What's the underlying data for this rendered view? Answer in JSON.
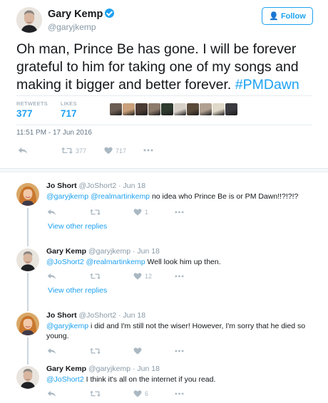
{
  "main_tweet": {
    "display_name": "Gary Kemp",
    "handle": "@garyjkemp",
    "follow_label": "Follow",
    "text": "Oh man, Prince Be has gone. I will be forever grateful to him for taking one of my songs and making it bigger and better forever. ",
    "hashtag": "#PMDawn",
    "retweets_label": "RETWEETS",
    "retweets_count": "377",
    "likes_label": "LIKES",
    "likes_count": "717",
    "timestamp": "11:51 PM - 17 Jun 2016",
    "action_retweets": "377",
    "action_likes": "717",
    "liker_avatar_colors": [
      "#6b5d52",
      "#c9a07a",
      "#4a3b35",
      "#8c7a6b",
      "#2f3a2f",
      "#d8d0c8",
      "#5a4a3a",
      "#b0a090",
      "#e0d8c8",
      "#3a3a40"
    ]
  },
  "replies": [
    {
      "display_name": "Jo Short",
      "meta": "@JoShort2 · Jun 18",
      "mentions": "@garyjkemp @realmartinkemp",
      "text": " no idea who Prince Be is or PM Dawn!!?!?!?",
      "likes": "1",
      "view_other": "View other replies",
      "avatar": "jo"
    },
    {
      "display_name": "Gary Kemp",
      "meta": "@garyjkemp · Jun 18",
      "mentions": "@JoShort2 @realmartinkemp",
      "text": " Well look him up then.",
      "likes": "12",
      "view_other": "View other replies",
      "avatar": "gary"
    },
    {
      "display_name": "Jo Short",
      "meta": "@JoShort2 · Jun 18",
      "mentions": "@garyjkemp",
      "text": " i did and I'm still not the wiser! However, I'm sorry that he died so young.",
      "likes": "",
      "avatar": "jo"
    },
    {
      "display_name": "Gary Kemp",
      "meta": "@garyjkemp · Jun 18",
      "mentions": "@JoShort2",
      "text": " I think it's all on the internet if you read.",
      "likes": "6",
      "avatar": "gary"
    }
  ],
  "colors": {
    "accent": "#1da1f2",
    "muted": "#8899a6",
    "icon": "#aab8c2",
    "text": "#14171a"
  }
}
